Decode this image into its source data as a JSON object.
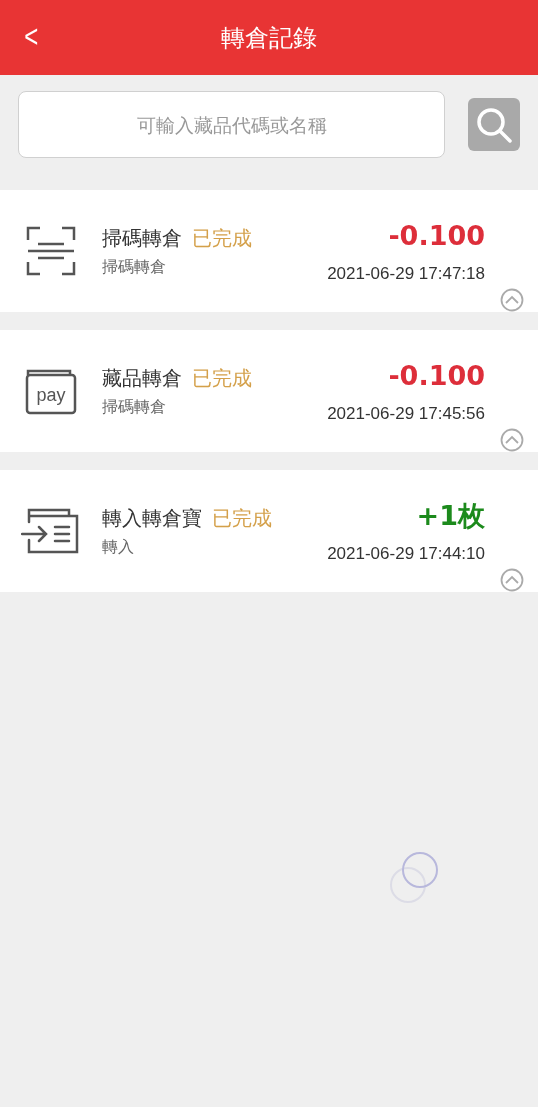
{
  "header": {
    "back": "<",
    "title": "轉倉記錄"
  },
  "search": {
    "placeholder": "可輸入藏品代碼或名稱"
  },
  "records": [
    {
      "kind": "scan",
      "title": "掃碼轉倉",
      "status": "已完成",
      "subtitle": "掃碼轉倉",
      "amount": "-0.100",
      "color": "#dd2e3a",
      "time": "2021-06-29 17:47:18",
      "expanded": false
    },
    {
      "kind": "pay",
      "icon_text": "pay",
      "title": "藏品轉倉",
      "status": "已完成",
      "subtitle": "掃碼轉倉",
      "amount": "-0.100",
      "color": "#dd2e3a",
      "time": "2021-06-29 17:45:56",
      "expanded": false
    },
    {
      "kind": "transfer_in",
      "title": "轉入轉倉寶",
      "status": "已完成",
      "subtitle": "轉入",
      "amount": "+1枚",
      "color": "#1c8a1c",
      "time": "2021-06-29 17:44:10",
      "expanded": false
    }
  ],
  "loading": true
}
